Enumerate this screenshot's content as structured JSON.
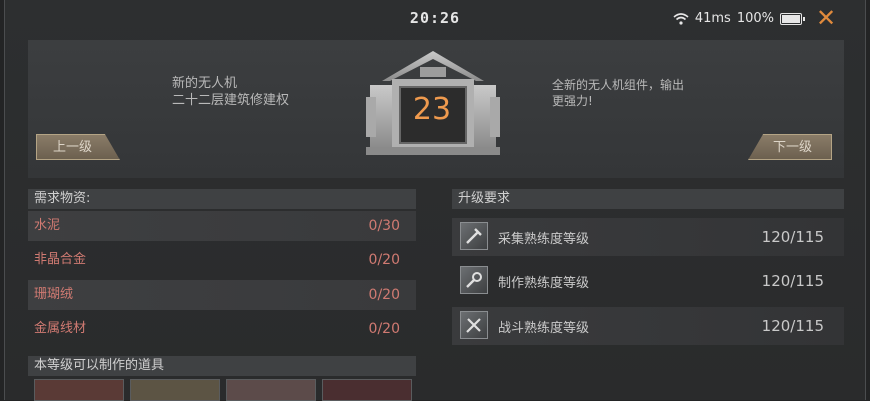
{
  "status": {
    "time": "20:26",
    "ping": "41ms",
    "battery": "100%"
  },
  "header": {
    "left_line1": "新的无人机",
    "left_line2": "二十二层建筑修建权",
    "level": "23",
    "right_line1": "全新的无人机组件，输出",
    "right_line2": "更强力!",
    "prev_label": "上一级",
    "next_label": "下一级"
  },
  "materials": {
    "title": "需求物资:",
    "items": [
      {
        "name": "水泥",
        "value": "0/30"
      },
      {
        "name": "非晶合金",
        "value": "0/20"
      },
      {
        "name": "珊瑚绒",
        "value": "0/20"
      },
      {
        "name": "金属线材",
        "value": "0/20"
      }
    ],
    "craft_title": "本等级可以制作的道具"
  },
  "requirements": {
    "title": "升级要求",
    "items": [
      {
        "icon": "gather-skill-icon",
        "name": "采集熟练度等级",
        "value": "120/115"
      },
      {
        "icon": "craft-skill-icon",
        "name": "制作熟练度等级",
        "value": "120/115"
      },
      {
        "icon": "combat-skill-icon",
        "name": "战斗熟练度等级",
        "value": "120/115"
      }
    ]
  },
  "colors": {
    "accent": "#ef9a4e",
    "shortage": "#d07a72",
    "close": "#e08a3c"
  }
}
